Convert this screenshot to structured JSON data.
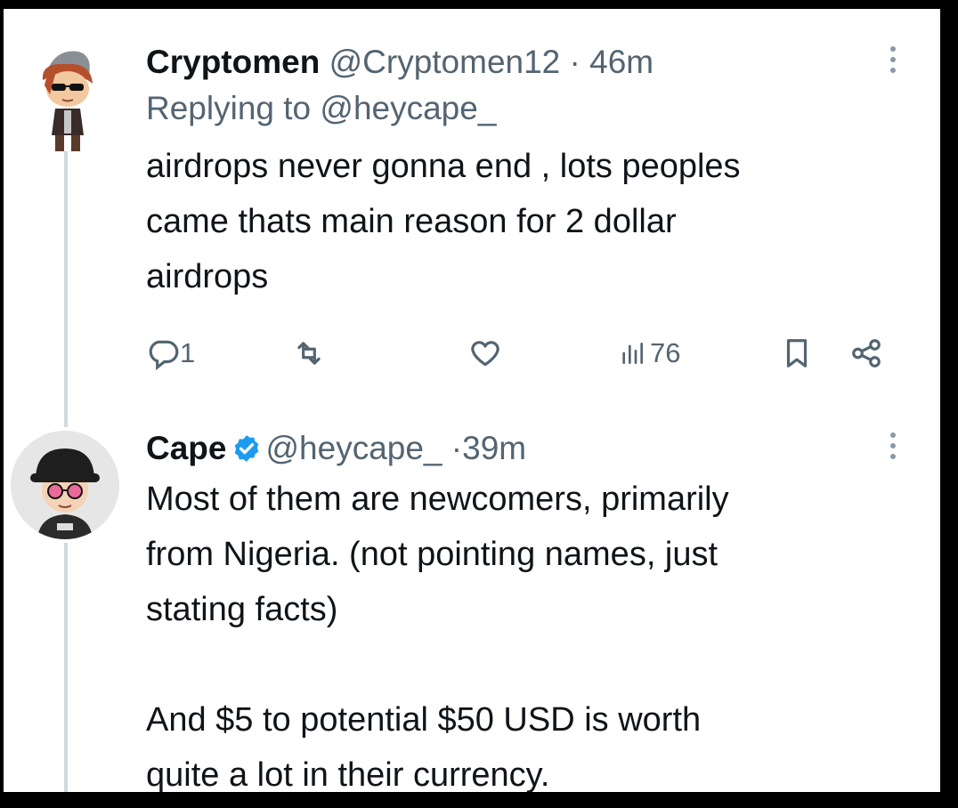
{
  "tweets": [
    {
      "display_name": "Cryptomen",
      "handle": "@Cryptomen12",
      "time": "46m",
      "replying_prefix": "Replying to ",
      "replying_to": "@heycape_",
      "text": "airdrops never gonna end , lots peoples\ncame thats main reason for 2 dollar\nairdrops",
      "avatar_icon": "cartoon-boy-avatar",
      "actions": {
        "replies": "1",
        "retweets": "",
        "likes": "",
        "views": "76"
      }
    },
    {
      "display_name": "Cape",
      "verified": true,
      "handle": "@heycape_",
      "time": "39m",
      "text": "Most of them are newcomers, primarily\nfrom Nigeria. (not pointing names, just\nstating facts)\n\nAnd $5 to potential $50 USD is worth\nquite a lot in their currency.",
      "avatar_icon": "cartoon-bucket-hat-avatar"
    }
  ],
  "colors": {
    "text_primary": "#0f1419",
    "text_secondary": "#536471",
    "verified_blue": "#1d9bf0",
    "thread_line": "#cfd9de"
  }
}
